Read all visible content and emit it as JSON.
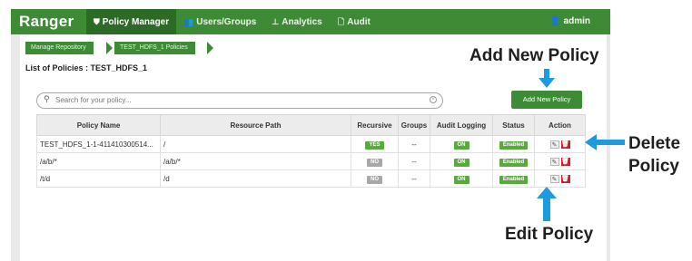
{
  "navbar": {
    "brand": "Ranger",
    "items": [
      {
        "icon": "shield-icon",
        "label": "Policy Manager",
        "active": true
      },
      {
        "icon": "users-icon",
        "label": "Users/Groups"
      },
      {
        "icon": "analytics-icon",
        "label": "Analytics"
      },
      {
        "icon": "audit-icon",
        "label": "Audit"
      }
    ],
    "user": "admin"
  },
  "breadcrumb": [
    "Manage Repository",
    "TEST_HDFS_1 Policies"
  ],
  "list_title": "List of Policies : TEST_HDFS_1",
  "search": {
    "placeholder": "Search for your policy..."
  },
  "add_button": "Add New Policy",
  "table": {
    "columns": [
      "Policy Name",
      "Resource Path",
      "Recursive",
      "Groups",
      "Audit Logging",
      "Status",
      "Action"
    ],
    "rows": [
      {
        "name": "TEST_HDFS_1-1-411410300514...",
        "path": "/",
        "recursive": "YES",
        "groups": "--",
        "audit": "ON",
        "status": "Enabled"
      },
      {
        "name": "/a/b/*",
        "path": "/a/b/*",
        "recursive": "NO",
        "groups": "--",
        "audit": "ON",
        "status": "Enabled"
      },
      {
        "name": "/t/d",
        "path": "/d",
        "recursive": "NO",
        "groups": "--",
        "audit": "ON",
        "status": "Enabled"
      }
    ]
  },
  "callouts": {
    "add": "Add New Policy",
    "delete_line1": "Delete",
    "delete_line2": "Policy",
    "edit": "Edit Policy"
  },
  "colors": {
    "brand_green": "#3d8c35",
    "arrow_blue": "#1e9ae0",
    "delete_red": "#cf2027"
  }
}
